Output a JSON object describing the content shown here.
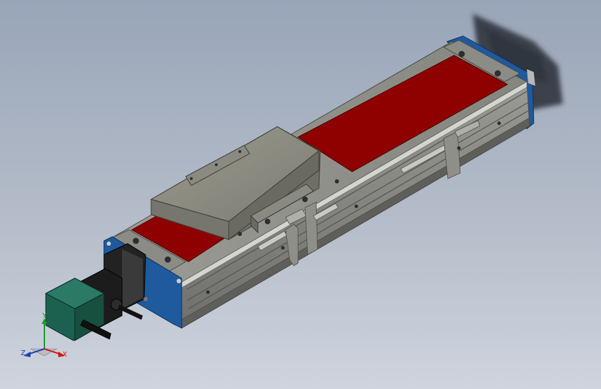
{
  "viewport": {
    "background_top": "#98a5b8",
    "background_bottom": "#cfd4de"
  },
  "model": {
    "rail_color": "#8b8b87",
    "cover_color": "#8f0000",
    "end_plate_color": "#1f5a9f",
    "carriage_color": "#8a8a82",
    "motor_color": "#1c6150"
  },
  "triad": {
    "x_label": "X",
    "y_label": "Y",
    "z_label": "Z",
    "x_color": "#d21818",
    "y_color": "#1b9a2a",
    "z_color": "#1f3fb0"
  }
}
